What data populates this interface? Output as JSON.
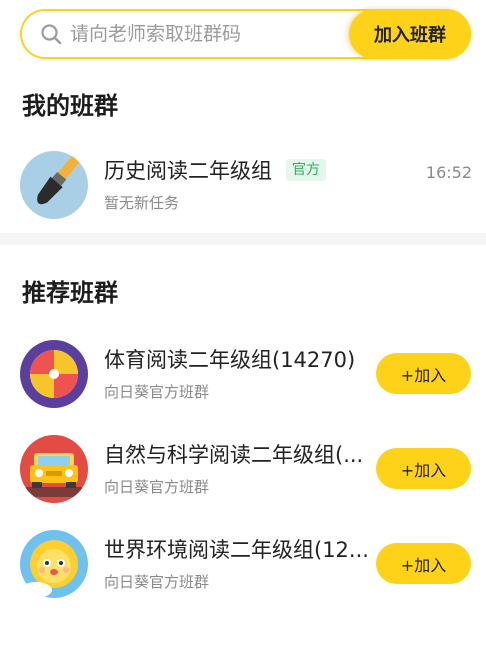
{
  "search": {
    "placeholder": "请向老师索取班群码",
    "join_label": "加入班群"
  },
  "my_groups": {
    "title": "我的班群",
    "items": [
      {
        "name": "历史阅读二年级组",
        "badge": "官方",
        "subtitle": "暂无新任务",
        "time": "16:52",
        "icon": "brush-icon"
      }
    ]
  },
  "recommended": {
    "title": "推荐班群",
    "items": [
      {
        "name": "体育阅读二年级组(14270)",
        "subtitle": "向日葵官方班群",
        "action": "+加入",
        "icon": "beach-ball-icon"
      },
      {
        "name": "自然与科学阅读二年级组(...",
        "subtitle": "向日葵官方班群",
        "action": "+加入",
        "icon": "car-icon"
      },
      {
        "name": "世界环境阅读二年级组(12...",
        "subtitle": "向日葵官方班群",
        "action": "+加入",
        "icon": "sun-icon"
      }
    ]
  },
  "colors": {
    "accent": "#ffd21a",
    "badge_text": "#2fae5c",
    "badge_bg": "#e6f6ec"
  }
}
